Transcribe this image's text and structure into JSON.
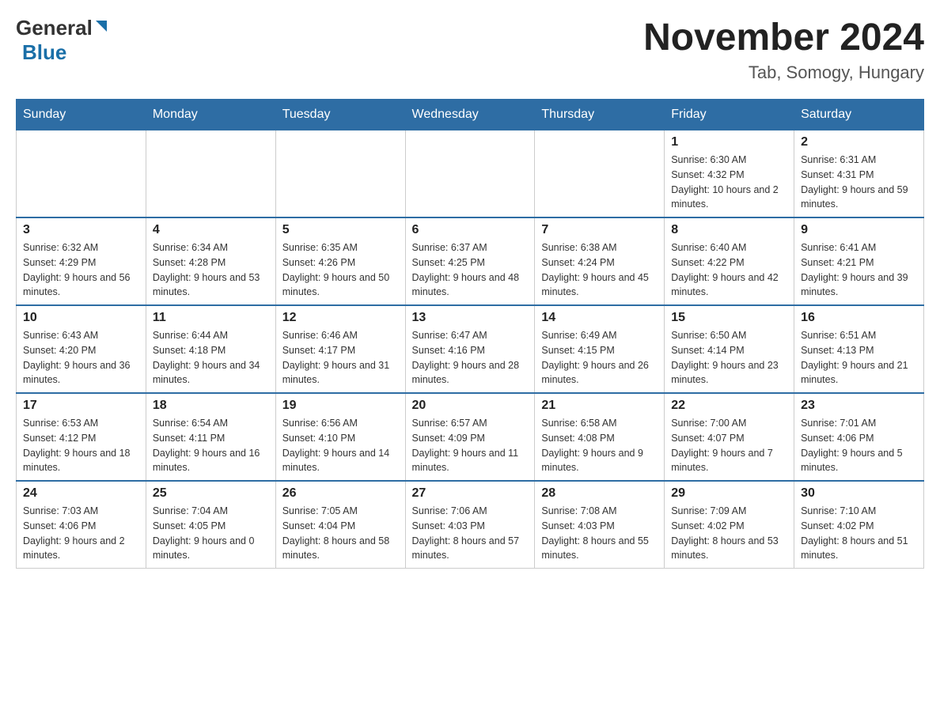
{
  "header": {
    "logo_general": "General",
    "logo_blue": "Blue",
    "month_year": "November 2024",
    "location": "Tab, Somogy, Hungary"
  },
  "weekdays": [
    "Sunday",
    "Monday",
    "Tuesday",
    "Wednesday",
    "Thursday",
    "Friday",
    "Saturday"
  ],
  "weeks": [
    [
      {
        "day": "",
        "info": ""
      },
      {
        "day": "",
        "info": ""
      },
      {
        "day": "",
        "info": ""
      },
      {
        "day": "",
        "info": ""
      },
      {
        "day": "",
        "info": ""
      },
      {
        "day": "1",
        "info": "Sunrise: 6:30 AM\nSunset: 4:32 PM\nDaylight: 10 hours and 2 minutes."
      },
      {
        "day": "2",
        "info": "Sunrise: 6:31 AM\nSunset: 4:31 PM\nDaylight: 9 hours and 59 minutes."
      }
    ],
    [
      {
        "day": "3",
        "info": "Sunrise: 6:32 AM\nSunset: 4:29 PM\nDaylight: 9 hours and 56 minutes."
      },
      {
        "day": "4",
        "info": "Sunrise: 6:34 AM\nSunset: 4:28 PM\nDaylight: 9 hours and 53 minutes."
      },
      {
        "day": "5",
        "info": "Sunrise: 6:35 AM\nSunset: 4:26 PM\nDaylight: 9 hours and 50 minutes."
      },
      {
        "day": "6",
        "info": "Sunrise: 6:37 AM\nSunset: 4:25 PM\nDaylight: 9 hours and 48 minutes."
      },
      {
        "day": "7",
        "info": "Sunrise: 6:38 AM\nSunset: 4:24 PM\nDaylight: 9 hours and 45 minutes."
      },
      {
        "day": "8",
        "info": "Sunrise: 6:40 AM\nSunset: 4:22 PM\nDaylight: 9 hours and 42 minutes."
      },
      {
        "day": "9",
        "info": "Sunrise: 6:41 AM\nSunset: 4:21 PM\nDaylight: 9 hours and 39 minutes."
      }
    ],
    [
      {
        "day": "10",
        "info": "Sunrise: 6:43 AM\nSunset: 4:20 PM\nDaylight: 9 hours and 36 minutes."
      },
      {
        "day": "11",
        "info": "Sunrise: 6:44 AM\nSunset: 4:18 PM\nDaylight: 9 hours and 34 minutes."
      },
      {
        "day": "12",
        "info": "Sunrise: 6:46 AM\nSunset: 4:17 PM\nDaylight: 9 hours and 31 minutes."
      },
      {
        "day": "13",
        "info": "Sunrise: 6:47 AM\nSunset: 4:16 PM\nDaylight: 9 hours and 28 minutes."
      },
      {
        "day": "14",
        "info": "Sunrise: 6:49 AM\nSunset: 4:15 PM\nDaylight: 9 hours and 26 minutes."
      },
      {
        "day": "15",
        "info": "Sunrise: 6:50 AM\nSunset: 4:14 PM\nDaylight: 9 hours and 23 minutes."
      },
      {
        "day": "16",
        "info": "Sunrise: 6:51 AM\nSunset: 4:13 PM\nDaylight: 9 hours and 21 minutes."
      }
    ],
    [
      {
        "day": "17",
        "info": "Sunrise: 6:53 AM\nSunset: 4:12 PM\nDaylight: 9 hours and 18 minutes."
      },
      {
        "day": "18",
        "info": "Sunrise: 6:54 AM\nSunset: 4:11 PM\nDaylight: 9 hours and 16 minutes."
      },
      {
        "day": "19",
        "info": "Sunrise: 6:56 AM\nSunset: 4:10 PM\nDaylight: 9 hours and 14 minutes."
      },
      {
        "day": "20",
        "info": "Sunrise: 6:57 AM\nSunset: 4:09 PM\nDaylight: 9 hours and 11 minutes."
      },
      {
        "day": "21",
        "info": "Sunrise: 6:58 AM\nSunset: 4:08 PM\nDaylight: 9 hours and 9 minutes."
      },
      {
        "day": "22",
        "info": "Sunrise: 7:00 AM\nSunset: 4:07 PM\nDaylight: 9 hours and 7 minutes."
      },
      {
        "day": "23",
        "info": "Sunrise: 7:01 AM\nSunset: 4:06 PM\nDaylight: 9 hours and 5 minutes."
      }
    ],
    [
      {
        "day": "24",
        "info": "Sunrise: 7:03 AM\nSunset: 4:06 PM\nDaylight: 9 hours and 2 minutes."
      },
      {
        "day": "25",
        "info": "Sunrise: 7:04 AM\nSunset: 4:05 PM\nDaylight: 9 hours and 0 minutes."
      },
      {
        "day": "26",
        "info": "Sunrise: 7:05 AM\nSunset: 4:04 PM\nDaylight: 8 hours and 58 minutes."
      },
      {
        "day": "27",
        "info": "Sunrise: 7:06 AM\nSunset: 4:03 PM\nDaylight: 8 hours and 57 minutes."
      },
      {
        "day": "28",
        "info": "Sunrise: 7:08 AM\nSunset: 4:03 PM\nDaylight: 8 hours and 55 minutes."
      },
      {
        "day": "29",
        "info": "Sunrise: 7:09 AM\nSunset: 4:02 PM\nDaylight: 8 hours and 53 minutes."
      },
      {
        "day": "30",
        "info": "Sunrise: 7:10 AM\nSunset: 4:02 PM\nDaylight: 8 hours and 51 minutes."
      }
    ]
  ]
}
